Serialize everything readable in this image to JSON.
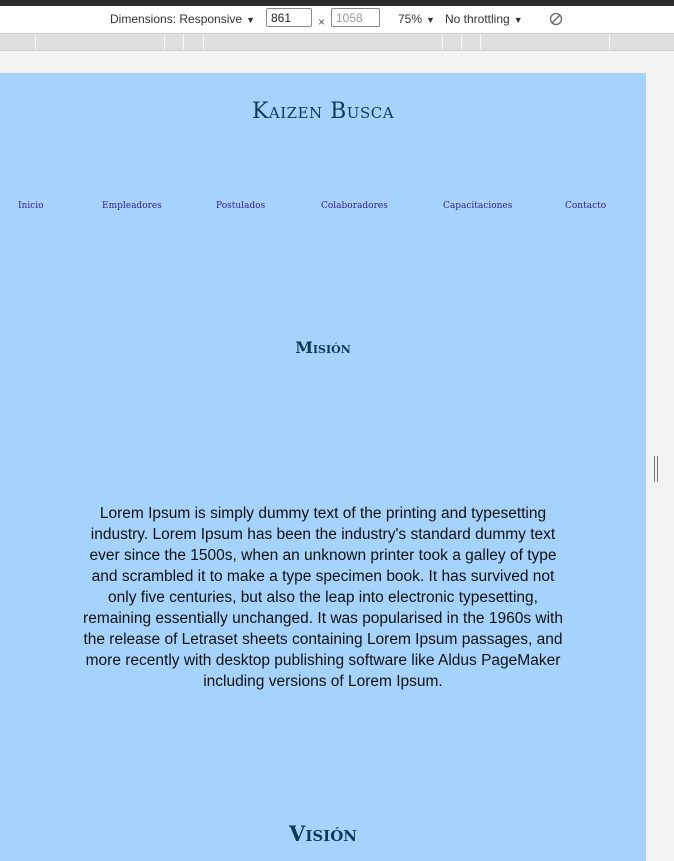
{
  "devtools": {
    "dimensions_label": "Dimensions: Responsive",
    "width_value": "861",
    "height_placeholder": "1058",
    "times_sign": "×",
    "zoom": "75%",
    "throttling": "No throttling",
    "caret": "▼"
  },
  "site": {
    "title": "Kaizen Busca",
    "nav": [
      "Inicio",
      "Empleadores",
      "Postulados",
      "Colaboradores",
      "Capacitaciones",
      "Contacto"
    ],
    "mision_heading": "Misión",
    "mision_text": "Lorem Ipsum is simply dummy text of the printing and typesetting industry. Lorem Ipsum has been the industry's standard dummy text ever since the 1500s, when an unknown printer took a galley of type and scrambled it to make a type specimen book. It has survived not only five centuries, but also the leap into electronic typesetting, remaining essentially unchanged. It was popularised in the 1960s with the release of Letraset sheets containing Lorem Ipsum passages, and more recently with desktop publishing software like Aldus PageMaker including versions of Lorem Ipsum.",
    "vision_heading": "Visión"
  },
  "colors": {
    "page_bg": "#a6d3fc",
    "heading": "#0d3b53",
    "nav_link": "#3a1a8c"
  },
  "icons": {
    "rotate": "rotate-icon",
    "resize": "resize-handle-icon"
  }
}
